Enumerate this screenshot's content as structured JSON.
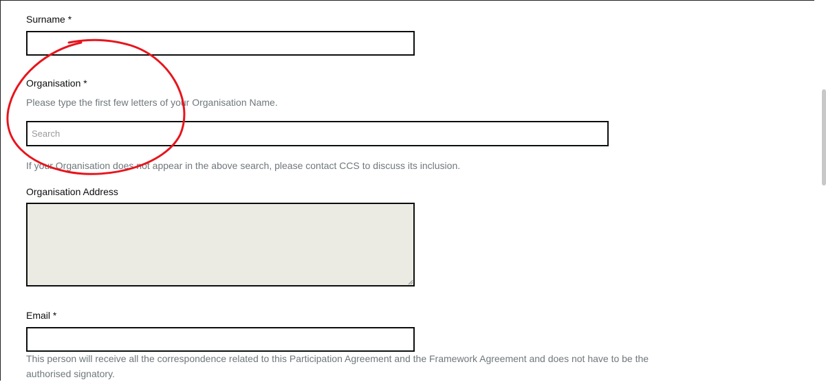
{
  "form": {
    "surname": {
      "label": "Surname *",
      "value": ""
    },
    "organisation": {
      "label": "Organisation *",
      "hint": "Please type the first few letters of your Organisation Name.",
      "placeholder": "Search",
      "value": "",
      "note": "If your Organisation does not appear in the above search, please contact CCS to discuss its inclusion."
    },
    "organisation_address": {
      "label": "Organisation Address",
      "value": ""
    },
    "email": {
      "label": "Email *",
      "value": "",
      "hint_line1": "This person will receive all the correspondence related to this Participation Agreement and the Framework Agreement and does not have to be the",
      "hint_line2": "authorised signatory."
    }
  },
  "colors": {
    "text": "#0b0c0c",
    "hint": "#6f777b",
    "readonly_bg": "#ebebe4",
    "annotation_circle": "#e8141c"
  },
  "icons": {
    "resize": "resize-grip-icon"
  }
}
